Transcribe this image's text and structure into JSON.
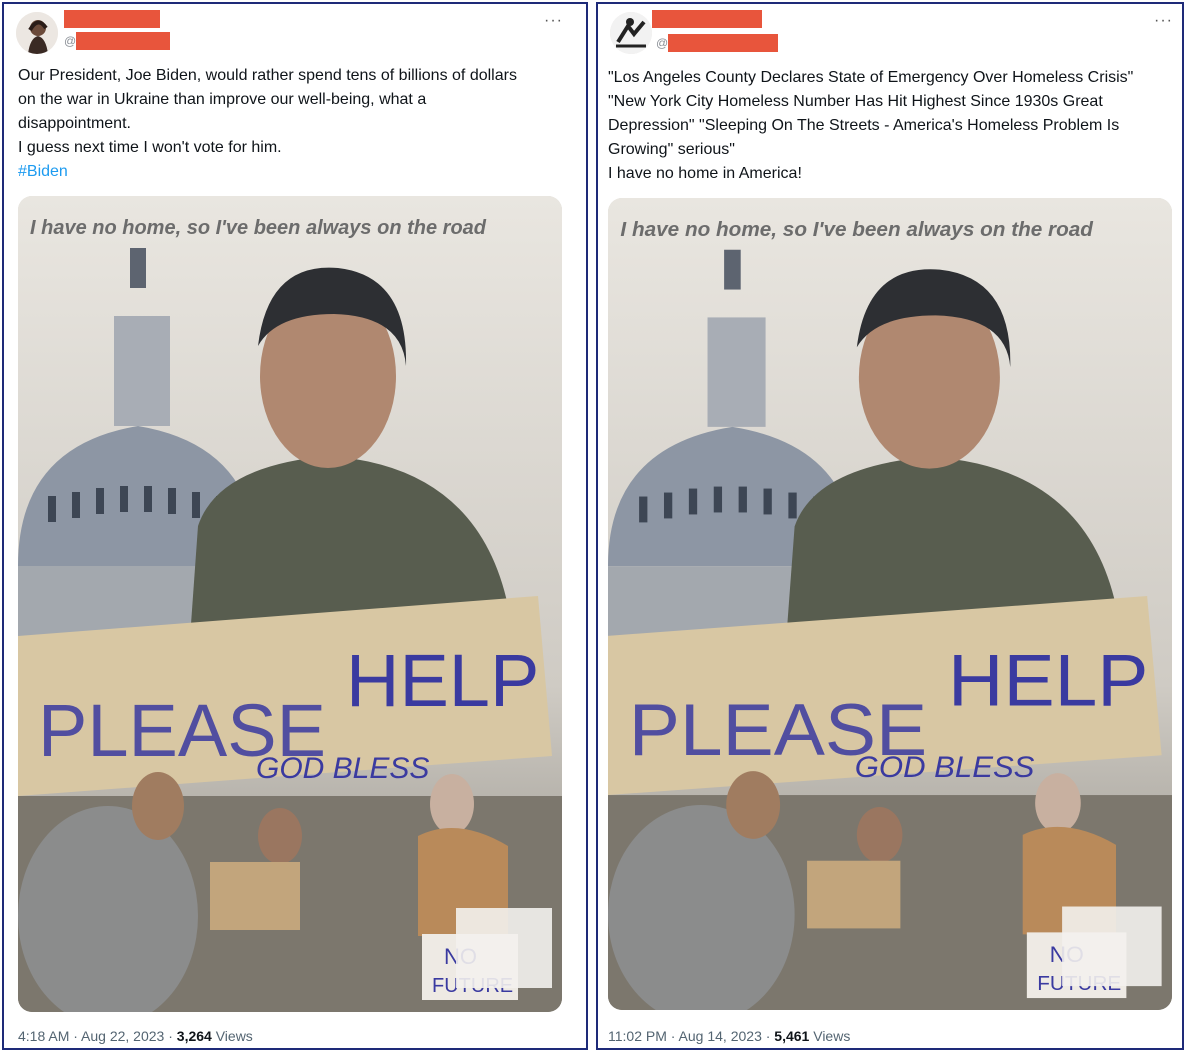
{
  "left_post": {
    "handle_prefix": "@",
    "more": "···",
    "text_lines": [
      "Our President, Joe Biden, would rather spend tens of billions of dollars",
      "on the war in Ukraine than improve our well-being, what a",
      "disappointment.",
      "I guess next time I won't vote for him."
    ],
    "hashtag": "#Biden",
    "image": {
      "caption": "I have no home, so I've been always on the road",
      "sign_main_1": "PLEASE",
      "sign_main_2": "HELP",
      "sign_sub": "GOD BLESS",
      "sign_small_1": "NO",
      "sign_small_2": "FUTURE"
    },
    "time": "4:18 AM · Aug 22, 2023 · ",
    "views_count": "3,264",
    "views_label": " Views"
  },
  "right_post": {
    "handle_prefix": "@",
    "more": "···",
    "text_lines": [
      "\"Los Angeles County Declares State of Emergency Over Homeless Crisis\"",
      "\"New York City Homeless Number Has Hit Highest Since 1930s Great",
      "Depression\" \"Sleeping On The Streets - America's Homeless Problem Is",
      "Growing\" serious\"",
      "I have no home in America!"
    ],
    "image": {
      "caption": "I have no home, so I've been always on the road",
      "sign_main_1": "PLEASE",
      "sign_main_2": "HELP",
      "sign_sub": "GOD BLESS",
      "sign_small_1": "NO",
      "sign_small_2": "FUTURE"
    },
    "time": "11:02 PM · Aug 14, 2023 · ",
    "views_count": "5,461",
    "views_label": " Views"
  },
  "colors": {
    "redaction": "#e8553c",
    "hashtag": "#1d9bf0",
    "panel_border": "#1e2a78",
    "sign_ink": "#3a3aa0"
  }
}
